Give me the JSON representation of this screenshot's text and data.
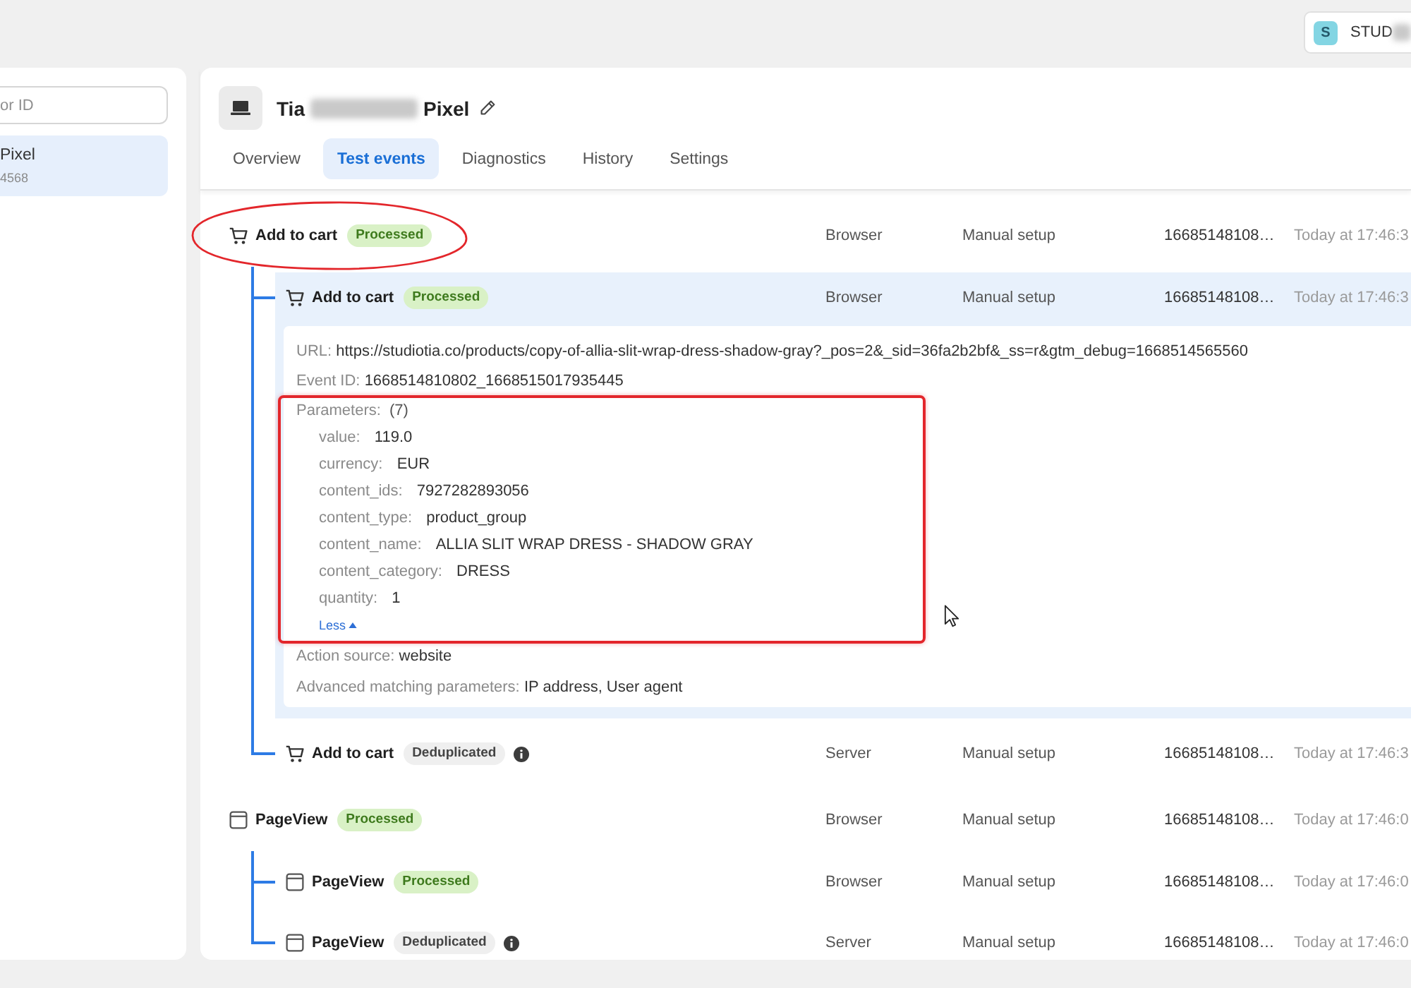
{
  "account": {
    "initial": "S",
    "name": "STUD",
    "redacted": true
  },
  "sidebar": {
    "search": {
      "placeholder": "or ID"
    },
    "items": [
      {
        "name": "Pixel",
        "id": "4568",
        "selected": true
      }
    ]
  },
  "pixel": {
    "title_start": "Tia",
    "title_end": "Pixel",
    "redacted": true
  },
  "tabs": [
    {
      "label": "Overview",
      "selected": false
    },
    {
      "label": "Test events",
      "selected": true
    },
    {
      "label": "Diagnostics",
      "selected": false
    },
    {
      "label": "History",
      "selected": false
    },
    {
      "label": "Settings",
      "selected": false
    }
  ],
  "events": [
    {
      "kind": "add_to_cart",
      "name": "Add to cart",
      "status": {
        "label": "Processed",
        "kind": "processed"
      },
      "circled": true,
      "source": "Browser",
      "setup": "Manual setup",
      "event_id": "16685148108…",
      "time": "Today at 17:46:3",
      "children": [
        {
          "kind": "add_to_cart",
          "name": "Add to cart",
          "status": {
            "label": "Processed",
            "kind": "processed"
          },
          "expanded": true,
          "source": "Browser",
          "setup": "Manual setup",
          "event_id": "16685148108…",
          "time": "Today at 17:46:3",
          "details": {
            "fields": [
              {
                "label": "URL:",
                "value": "https://studiotia.co/products/copy-of-allia-slit-wrap-dress-shadow-gray?_pos=2&_sid=36fa2b2bf&_ss=r&gtm_debug=1668514565560"
              },
              {
                "label": "Event ID:",
                "value": "1668514810802_1668515017935445"
              }
            ],
            "parameters": {
              "label": "Parameters:",
              "count": "(7)",
              "boxed": true,
              "items": [
                {
                  "key": "value:",
                  "value": "119.0"
                },
                {
                  "key": "currency:",
                  "value": "EUR"
                },
                {
                  "key": "content_ids:",
                  "value": "7927282893056"
                },
                {
                  "key": "content_type:",
                  "value": "product_group"
                },
                {
                  "key": "content_name:",
                  "value": "ALLIA SLIT WRAP DRESS - SHADOW GRAY"
                },
                {
                  "key": "content_category:",
                  "value": "DRESS"
                },
                {
                  "key": "quantity:",
                  "value": "1"
                }
              ],
              "toggle": "Less"
            },
            "more_fields": [
              {
                "label": "Action source:",
                "value": "website"
              },
              {
                "label": "Advanced matching parameters:",
                "value": "IP address, User agent"
              }
            ]
          }
        },
        {
          "kind": "add_to_cart",
          "name": "Add to cart",
          "status": {
            "label": "Deduplicated",
            "kind": "deduplicated"
          },
          "expanded": false,
          "source": "Server",
          "setup": "Manual setup",
          "event_id": "16685148108…",
          "time": "Today at 17:46:3"
        }
      ]
    },
    {
      "kind": "page_view",
      "name": "PageView",
      "status": {
        "label": "Processed",
        "kind": "processed"
      },
      "circled": false,
      "source": "Browser",
      "setup": "Manual setup",
      "event_id": "16685148108…",
      "time": "Today at 17:46:0",
      "children": [
        {
          "kind": "page_view",
          "name": "PageView",
          "status": {
            "label": "Processed",
            "kind": "processed"
          },
          "expanded": false,
          "source": "Browser",
          "setup": "Manual setup",
          "event_id": "16685148108…",
          "time": "Today at 17:46:0"
        },
        {
          "kind": "page_view",
          "name": "PageView",
          "status": {
            "label": "Deduplicated",
            "kind": "deduplicated"
          },
          "expanded": false,
          "source": "Server",
          "setup": "Manual setup",
          "event_id": "16685148108…",
          "time": "Today at 17:46:0"
        }
      ]
    }
  ]
}
